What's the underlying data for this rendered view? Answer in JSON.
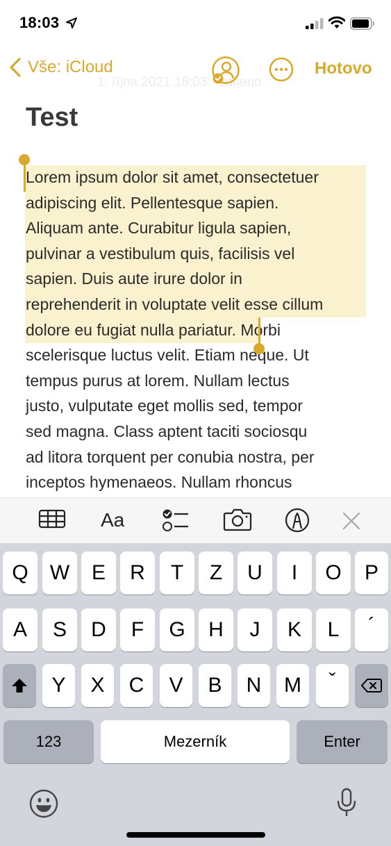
{
  "status_bar": {
    "time": "18:03"
  },
  "nav": {
    "back_label": "Vše: iCloud",
    "done_label": "Hotovo",
    "date_ghost": "1. října 2021 18:03 · sdíleno"
  },
  "note": {
    "title": "Test",
    "lines": [
      "Lorem ipsum dolor sit amet, consectetuer",
      "adipiscing elit. Pellentesque sapien.",
      "Aliquam ante. Curabitur ligula sapien,",
      "pulvinar a vestibulum quis, facilisis vel",
      "sapien. Duis aute irure dolor in",
      "reprehenderit in voluptate velit esse cillum",
      "dolore eu fugiat nulla pariatur. Morbi",
      "scelerisque luctus velit. Etiam neque. Ut",
      "tempus purus at lorem. Nullam lectus",
      "justo, vulputate eget mollis sed, tempor",
      "sed magna. Class aptent taciti sociosqu",
      "ad litora torquent per conubia nostra, per",
      "inceptos hymenaeos. Nullam rhoncus"
    ]
  },
  "toolbar": {
    "text_format_label": "Aa",
    "icons": [
      "table-icon",
      "text-format-icon",
      "checklist-icon",
      "camera-icon",
      "markup-pen-icon",
      "close-icon"
    ]
  },
  "keyboard": {
    "row1": [
      "Q",
      "W",
      "E",
      "R",
      "T",
      "Z",
      "U",
      "I",
      "O",
      "P"
    ],
    "row2": [
      "A",
      "S",
      "D",
      "F",
      "G",
      "H",
      "J",
      "K",
      "L",
      "´"
    ],
    "row3": [
      "Y",
      "X",
      "C",
      "V",
      "B",
      "N",
      "M",
      "ˇ"
    ],
    "numbers_label": "123",
    "space_label": "Mezerník",
    "enter_label": "Enter"
  },
  "colors": {
    "accent": "#d9a92b",
    "selection": "#faf1cf",
    "keyboard_bg": "#d3d5dc"
  }
}
